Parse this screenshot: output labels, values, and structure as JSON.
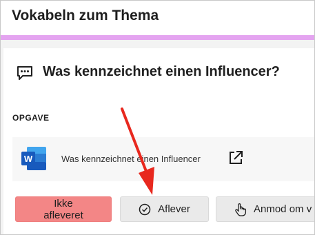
{
  "header": {
    "title": "Vokabeln zum Thema"
  },
  "assignment": {
    "title": "Was kennzeichnet einen Influencer?",
    "section_label": "OPGAVE",
    "attachment": {
      "name": "Was kennzeichnet einen Influencer",
      "icon": "word-file-icon",
      "action_icon": "open-external-icon"
    }
  },
  "actions": {
    "status_label": "Ikke afleveret",
    "submit_label": "Aflever",
    "request_label": "Anmod om v"
  },
  "colors": {
    "accent": "#e4a4f0",
    "status_bg": "#f38686",
    "word_blue": "#185abd",
    "annotation_arrow": "#e8281e"
  }
}
